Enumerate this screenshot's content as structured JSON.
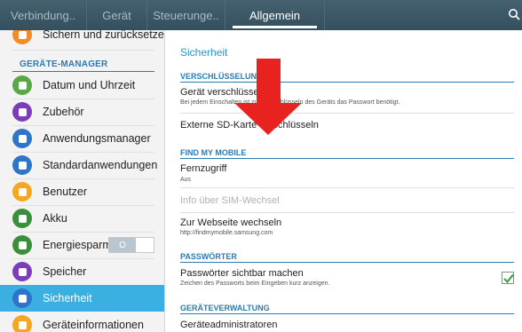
{
  "tabs": [
    {
      "label": "Verbindung..",
      "active": false
    },
    {
      "label": "Gerät",
      "active": false
    },
    {
      "label": "Steuerunge..",
      "active": false
    },
    {
      "label": "Allgemein",
      "active": true
    }
  ],
  "sidebar": {
    "top_item": {
      "label": "Sichern und zurücksetzen",
      "icon": "backup-icon",
      "color": "#f28c28"
    },
    "section_header": "GERÄTE-MANAGER",
    "items": [
      {
        "label": "Datum und Uhrzeit",
        "icon": "clock-icon",
        "color": "#5aa845",
        "active": false
      },
      {
        "label": "Zubehör",
        "icon": "accessory-icon",
        "color": "#7b3db8",
        "active": false
      },
      {
        "label": "Anwendungsmanager",
        "icon": "apps-icon",
        "color": "#2e74c9",
        "active": false
      },
      {
        "label": "Standardanwendungen",
        "icon": "default-apps-icon",
        "color": "#2e74c9",
        "active": false
      },
      {
        "label": "Benutzer",
        "icon": "users-icon",
        "color": "#f5a623",
        "active": false
      },
      {
        "label": "Akku",
        "icon": "battery-icon",
        "color": "#3a8f3a",
        "active": false
      },
      {
        "label": "Energiesparmod..",
        "icon": "power-saving-icon",
        "color": "#3a8f3a",
        "active": false,
        "toggle": "O"
      },
      {
        "label": "Speicher",
        "icon": "storage-icon",
        "color": "#7b3db8",
        "active": false
      },
      {
        "label": "Sicherheit",
        "icon": "lock-icon",
        "color": "#2e74c9",
        "active": true
      },
      {
        "label": "Geräteinformationen",
        "icon": "info-icon",
        "color": "#f5a623",
        "active": false
      }
    ]
  },
  "main": {
    "title": "Sicherheit",
    "sections": {
      "encryption": "VERSCHLÜSSELUNG",
      "find_my_mobile": "FIND MY MOBILE",
      "passwords": "PASSWÖRTER",
      "device_admin": "GERÄTEVERWALTUNG"
    },
    "rows": {
      "encrypt_device": {
        "title": "Gerät verschlüsseln",
        "sub": "Bei jedem Einschalten ist zum Entschlüsseln des Geräts das Passwort benötigt."
      },
      "encrypt_sd": {
        "title": "Externe SD-Karte verschlüsseln"
      },
      "remote": {
        "title": "Fernzugriff",
        "sub": "Aus"
      },
      "sim_change": {
        "title": "Info über SIM-Wechsel"
      },
      "website": {
        "title": "Zur Webseite wechseln",
        "sub": "http://findmymobile.samsung.com"
      },
      "show_passwords": {
        "title": "Passwörter sichtbar machen",
        "sub": "Zeichen des Passworts beim Eingeben kurz anzeigen.",
        "checked": true
      },
      "device_admins": {
        "title": "Geräteadministratoren"
      }
    }
  },
  "colors": {
    "accent": "#2b93c9",
    "active_item": "#3ab0e2",
    "annotation_arrow": "#e8231f",
    "checkmark": "#3aa845"
  }
}
